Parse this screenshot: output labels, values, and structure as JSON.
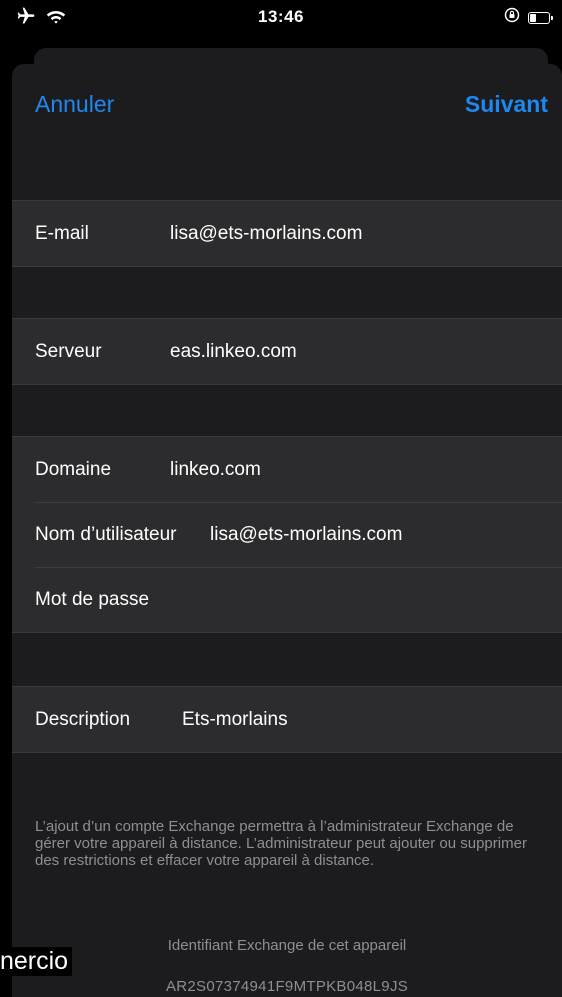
{
  "status_bar": {
    "time": "13:46",
    "left_icons": [
      "airplane-icon",
      "wifi-icon"
    ],
    "right_icons": [
      "orientation-lock-icon",
      "battery-icon"
    ]
  },
  "nav": {
    "cancel_label": "Annuler",
    "next_label": "Suivant",
    "accent_color": "#1e87f0"
  },
  "fields": {
    "email": {
      "label": "E-mail",
      "value": "lisa@ets-morlains.com"
    },
    "server": {
      "label": "Serveur",
      "value": "eas.linkeo.com"
    },
    "domain": {
      "label": "Domaine",
      "value": "linkeo.com"
    },
    "username": {
      "label": "Nom d’utilisateur",
      "value": "lisa@ets-morlains.com"
    },
    "password": {
      "label": "Mot de passe",
      "value": ""
    },
    "description": {
      "label": "Description",
      "value": "Ets-morlains"
    }
  },
  "footer": {
    "info_text": "L’ajout d’un compte Exchange permettra à l’administrateur Exchange de gérer votre appareil à distance. L’administrateur peut ajouter ou supprimer des restrictions et effacer votre appareil à distance.",
    "device_id_label": "Identifiant Exchange de cet appareil",
    "device_id": "AR2S07374941F9MTPKB048L9JS"
  },
  "background_peek_text": "nercio"
}
